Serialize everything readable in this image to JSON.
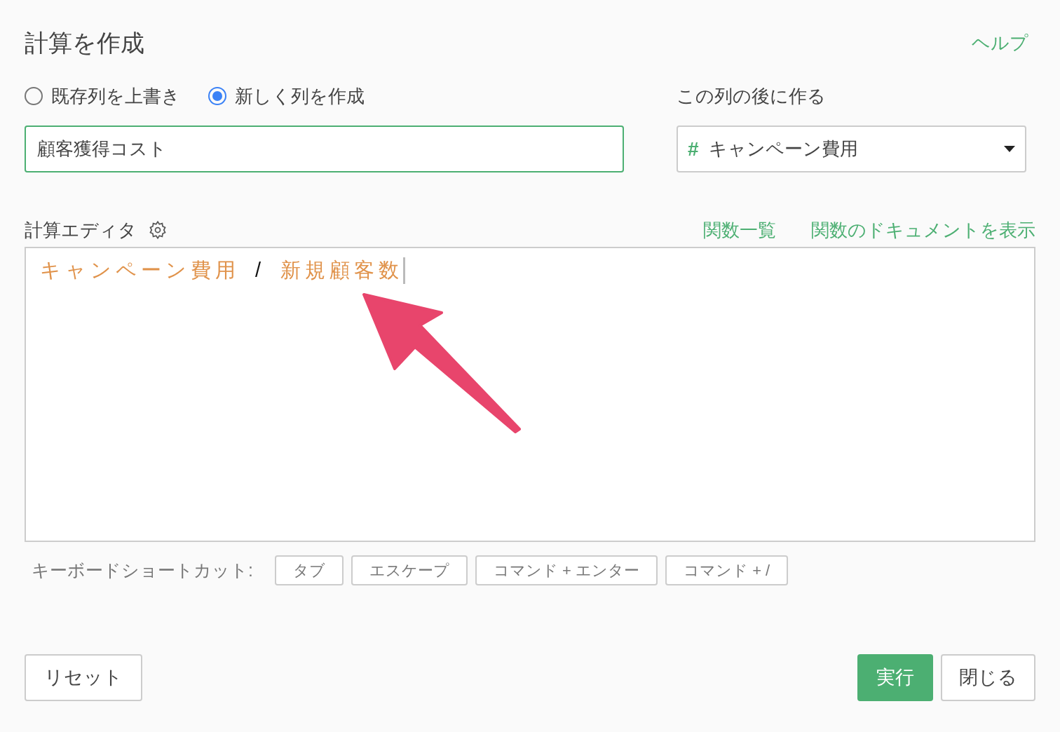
{
  "title": "計算を作成",
  "help_link": "ヘルプ",
  "mode_options": [
    {
      "label": "既存列を上書き",
      "selected": false
    },
    {
      "label": "新しく列を作成",
      "selected": true
    }
  ],
  "column_name": {
    "value": "顧客獲得コスト"
  },
  "position": {
    "label": "この列の後に作る",
    "type_symbol": "#",
    "value": "キャンペーン費用"
  },
  "editor": {
    "label": "計算エディタ",
    "links": [
      "関数一覧",
      "関数のドキュメントを表示"
    ],
    "tokens": [
      {
        "kind": "column",
        "text": "キャンペーン費用"
      },
      {
        "kind": "operator",
        "text": "/"
      },
      {
        "kind": "column",
        "text": "新規顧客数"
      }
    ]
  },
  "shortcuts": {
    "label": "キーボードショートカット:",
    "keys": [
      "タブ",
      "エスケープ",
      "コマンド + エンター",
      "コマンド + /"
    ]
  },
  "buttons": {
    "reset": "リセット",
    "run": "実行",
    "close": "閉じる"
  }
}
